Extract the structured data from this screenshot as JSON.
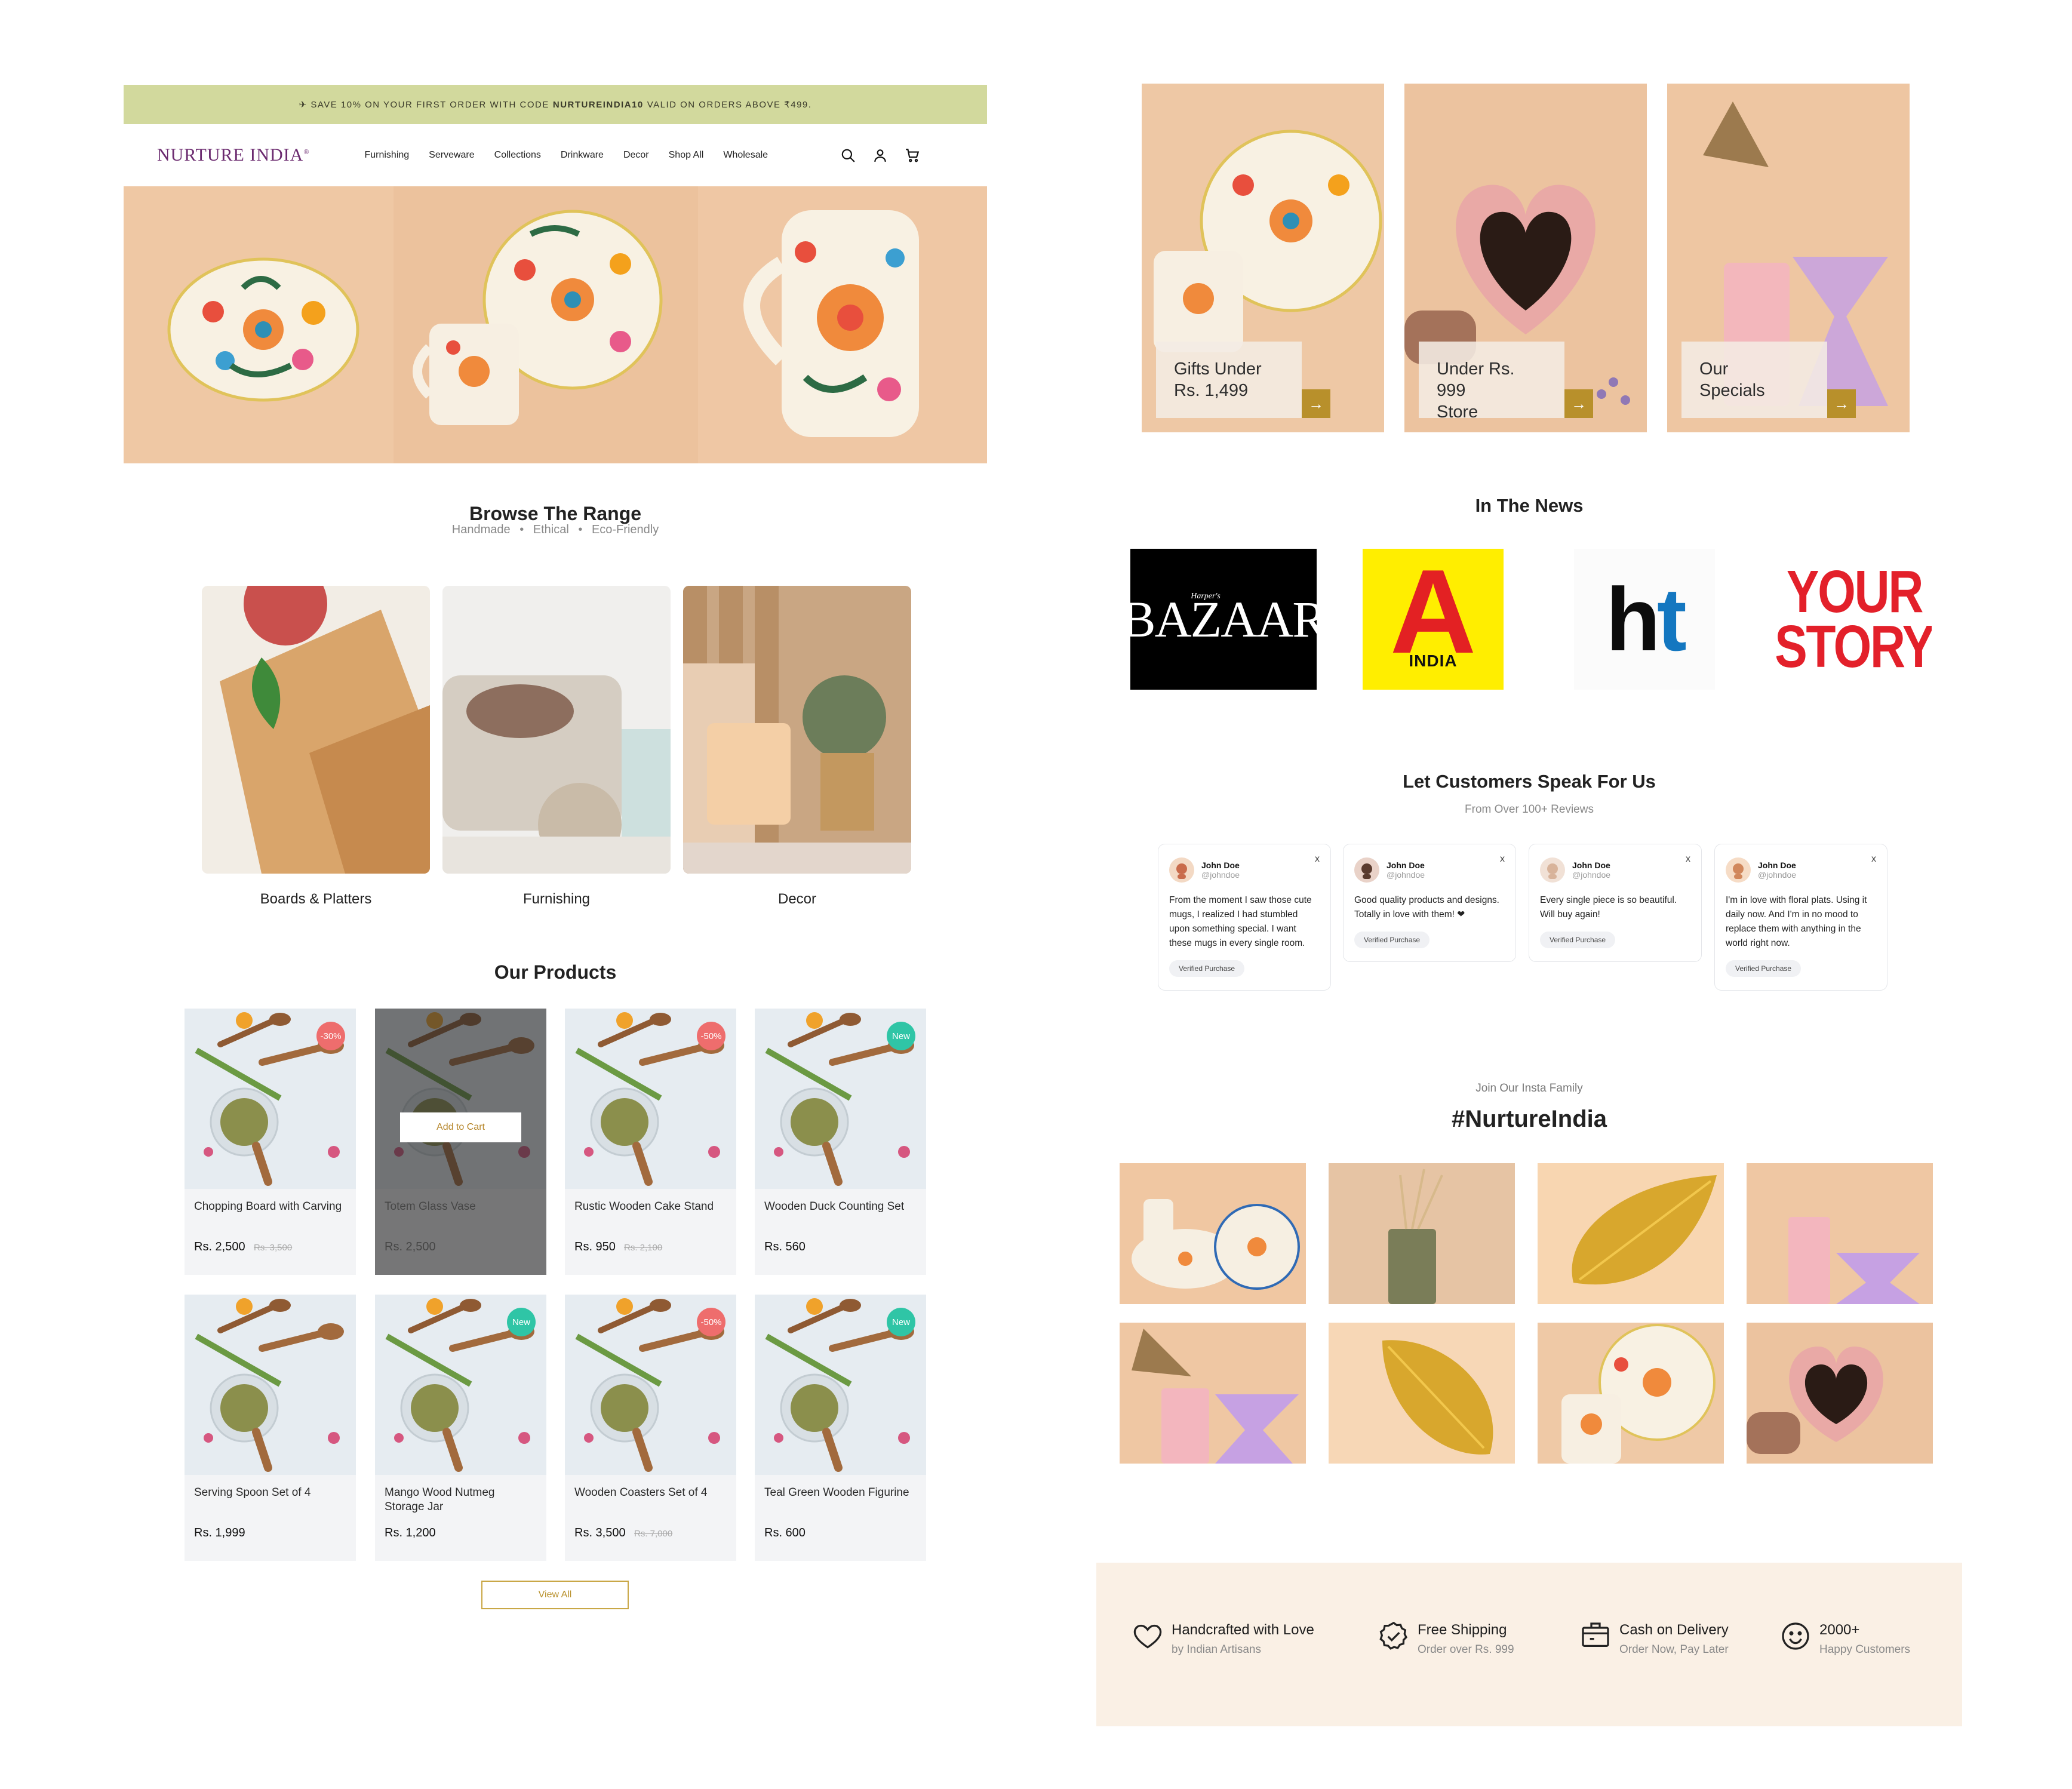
{
  "promo": {
    "prefix": "✈ SAVE 10% ON YOUR FIRST ORDER WITH CODE",
    "code": "NURTUREINDIA10",
    "suffix": "VALID ON ORDERS ABOVE ₹499."
  },
  "header": {
    "logo": "NURTURE INDIA",
    "logo_mark": "®",
    "nav": [
      "Furnishing",
      "Serveware",
      "Collections",
      "Drinkware",
      "Decor",
      "Shop All",
      "Wholesale"
    ],
    "icons": [
      "search-icon",
      "user-icon",
      "cart-icon"
    ]
  },
  "browse": {
    "title": "Browse The Range",
    "tags": [
      "Handmade",
      "Ethical",
      "Eco-Friendly"
    ],
    "separator": "•"
  },
  "categories": [
    "Boards & Platters",
    "Furnishing",
    "Decor"
  ],
  "products_section": {
    "title": "Our Products",
    "add_to_cart": "Add to Cart",
    "view_all": "View All"
  },
  "products": [
    {
      "name": "Chopping Board with Carving",
      "price": "Rs. 2,500",
      "old_price": "Rs. 3,500",
      "badge": "-30%",
      "badge_type": "sale"
    },
    {
      "name": "Totem Glass Vase",
      "price": "Rs. 2,500",
      "old_price": "",
      "badge": "",
      "badge_type": "",
      "hover": true
    },
    {
      "name": "Rustic Wooden Cake Stand",
      "price": "Rs. 950",
      "old_price": "Rs. 2,100",
      "badge": "-50%",
      "badge_type": "sale"
    },
    {
      "name": "Wooden Duck Counting Set",
      "price": "Rs. 560",
      "old_price": "",
      "badge": "New",
      "badge_type": "new"
    },
    {
      "name": "Serving Spoon Set of 4",
      "price": "Rs. 1,999",
      "old_price": "",
      "badge": "",
      "badge_type": ""
    },
    {
      "name": "Mango Wood Nutmeg Storage Jar",
      "price": "Rs. 1,200",
      "old_price": "",
      "badge": "New",
      "badge_type": "new"
    },
    {
      "name": "Wooden Coasters Set of 4",
      "price": "Rs. 3,500",
      "old_price": "Rs. 7,000",
      "badge": "-50%",
      "badge_type": "sale"
    },
    {
      "name": "Teal Green Wooden Figurine",
      "price": "Rs. 600",
      "old_price": "",
      "badge": "New",
      "badge_type": "new"
    }
  ],
  "promo_tiles": [
    {
      "line1": "Gifts Under",
      "line2": "Rs. 1,499"
    },
    {
      "line1": "Under Rs. 999",
      "line2": "Store"
    },
    {
      "line1": "Our",
      "line2": "Specials"
    }
  ],
  "news": {
    "title": "In The News",
    "logos": [
      {
        "name": "bazaar",
        "text": "BAZAAR",
        "small": "Harper's"
      },
      {
        "name": "architectural-digest",
        "text": "A",
        "small": "INDIA"
      },
      {
        "name": "hindustan-times",
        "text_h": "h",
        "text_t": "t"
      },
      {
        "name": "yourstory",
        "line1": "YOUR",
        "line2": "STORY"
      }
    ]
  },
  "reviews": {
    "title": "Let Customers Speak For Us",
    "subtitle": "From Over 100+ Reviews",
    "close": "x",
    "verified": "Verified Purchase",
    "items": [
      {
        "name": "John Doe",
        "handle": "@johndoe",
        "text": "From the moment I saw those cute mugs, I realized I had stumbled upon something special. I want these mugs in every single room."
      },
      {
        "name": "John Doe",
        "handle": "@johndoe",
        "text": "Good quality products and designs. Totally in love with them! ❤"
      },
      {
        "name": "John Doe",
        "handle": "@johndoe",
        "text": "Every single piece is so beautiful. Will buy again!"
      },
      {
        "name": "John Doe",
        "handle": "@johndoe",
        "text": "I'm in love with floral plats. Using it daily now. And I'm in no mood to replace them with anything in the world right now."
      }
    ]
  },
  "insta": {
    "kicker": "Join Our Insta Family",
    "tag": "#NurtureIndia"
  },
  "features": [
    {
      "icon": "heart-icon",
      "title": "Handcrafted with Love",
      "sub": "by Indian Artisans"
    },
    {
      "icon": "badge-check-icon",
      "title": "Free Shipping",
      "sub": "Order over Rs. 999"
    },
    {
      "icon": "box-icon",
      "title": "Cash on Delivery",
      "sub": "Order Now, Pay Later"
    },
    {
      "icon": "smiley-icon",
      "title": "2000+",
      "sub": "Happy Customers"
    }
  ],
  "colors": {
    "accent": "#b8902b",
    "promo_bar": "#d2d99d",
    "logo": "#6b2a6f",
    "sale": "#ee6d6d",
    "new": "#2fc5a6",
    "feature_bg": "#faf0e5"
  }
}
